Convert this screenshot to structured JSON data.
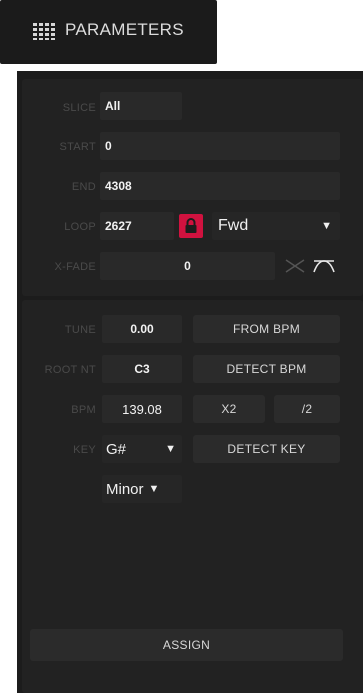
{
  "header": {
    "title": "PARAMETERS",
    "icon": "grid-icon"
  },
  "slice_section": {
    "slice": {
      "label": "SLICE",
      "value": "All"
    },
    "start": {
      "label": "START",
      "value": "0"
    },
    "end": {
      "label": "END",
      "value": "4308"
    },
    "loop": {
      "label": "LOOP",
      "value": "2627",
      "lock_icon": "lock-icon",
      "lock_color": "#d0123f"
    },
    "direction": {
      "value": "Fwd",
      "caret": "▼"
    },
    "xfade": {
      "label": "X-FADE",
      "value": "0",
      "curve_icons": [
        "linear-crossfade-icon",
        "curved-crossfade-icon"
      ]
    }
  },
  "tune_section": {
    "tune": {
      "label": "TUNE",
      "value": "0.00"
    },
    "from_bpm_button": "FROM BPM",
    "root_note": {
      "label": "ROOT NT",
      "value": "C3"
    },
    "detect_bpm_button": "DETECT BPM",
    "bpm": {
      "label": "BPM",
      "value": "139.08"
    },
    "x2_button": "X2",
    "half_button": "/2",
    "key": {
      "label": "KEY",
      "value": "G#",
      "caret": "▼"
    },
    "detect_key_button": "DETECT KEY",
    "scale": {
      "value": "Minor",
      "caret": "▼"
    },
    "assign_button": "ASSIGN"
  }
}
